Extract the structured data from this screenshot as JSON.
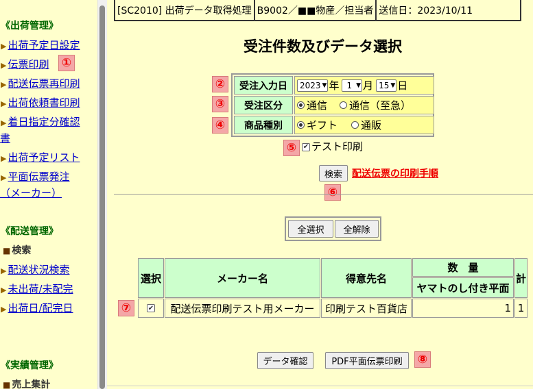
{
  "sidebar": {
    "shipping_title": "《出荷管理》",
    "shipping_items": [
      {
        "label": "出荷予定日設定"
      },
      {
        "label": "伝票印刷"
      },
      {
        "label": "配送伝票再印刷"
      },
      {
        "label": "出荷依頼書印刷"
      },
      {
        "label": "着日指定分確認",
        "cont": "書"
      },
      {
        "label": "出荷予定リスト"
      },
      {
        "label": "平面伝票発注",
        "cont": "（メーカー）"
      }
    ],
    "delivery_title": "《配送管理》",
    "delivery_current": "検索",
    "delivery_items": [
      {
        "label": "配送状況検索"
      },
      {
        "label": "未出荷/未配完"
      },
      {
        "label": "出荷日/配完日"
      }
    ],
    "results_title": "《実績管理》",
    "results_current": "売上集計"
  },
  "header": {
    "screen_id": "[SC2010] 出荷データ取得処理",
    "company": "B9002／■■物産／担当者",
    "sent_date": "送信日：2023/10/11"
  },
  "page_title": "受注件数及びデータ選択",
  "form": {
    "order_date_label": "受注入力日",
    "year": "2023",
    "year_unit": "年",
    "month": "1",
    "month_unit": "月",
    "day": "15",
    "day_unit": "日",
    "order_type_label": "受注区分",
    "order_type_options": [
      "通信",
      "通信（至急）"
    ],
    "order_type_selected": "通信",
    "product_type_label": "商品種別",
    "product_type_options": [
      "ギフト",
      "通販"
    ],
    "product_type_selected": "ギフト",
    "test_print_label": "テスト印刷",
    "test_print_checked": true
  },
  "search_button": "検索",
  "print_procedure_link": "配送伝票の印刷手順",
  "select_all_button": "全選択",
  "deselect_all_button": "全解除",
  "table": {
    "headers": {
      "select": "選択",
      "maker": "メーカー名",
      "customer": "得意先名",
      "quantity": "数　量",
      "yamato": "ヤマトのし付き平面",
      "total": "計"
    },
    "rows": [
      {
        "checked": true,
        "maker": "配送伝票印刷テスト用メーカー",
        "customer": "印刷テスト百貨店",
        "yamato": "1",
        "total": "1"
      }
    ]
  },
  "data_check_button": "データ確認",
  "pdf_print_button": "PDF平面伝票印刷",
  "badges": [
    "①",
    "②",
    "③",
    "④",
    "⑤",
    "⑥",
    "⑦",
    "⑧"
  ],
  "colors": {
    "background": "#ffffcc",
    "label_bg": "#ccffcc",
    "value_bg": "#ffff99",
    "link": "#0000cc",
    "section_title": "#006600",
    "badge_bg": "#f4a7a7",
    "badge_text": "#ee0000",
    "procedure_link": "#ee0000"
  }
}
